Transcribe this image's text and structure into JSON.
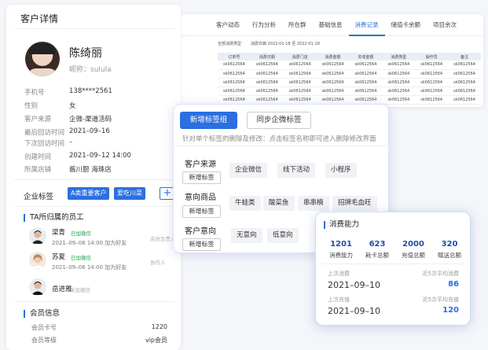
{
  "table_panel": {
    "tabs": [
      "客户动态",
      "行为分析",
      "所在群",
      "基础信息",
      "消费记录",
      "储值卡余额",
      "项目余次"
    ],
    "filter": [
      "全部消费类型",
      "消费日期 2022-01-18 至 2022-01-18"
    ],
    "headers": [
      "订单号",
      "消费日期",
      "消费门店",
      "消费金额",
      "实收金额",
      "消费类型",
      "操作员",
      "备注"
    ],
    "rows": [
      [
        "sk0612564",
        "sk0612564",
        "sk0612564",
        "sk0612564",
        "sk0612564",
        "sk0612564",
        "sk0612564",
        "sk0612564"
      ],
      [
        "sk0612564",
        "sk0612564",
        "sk0612564",
        "sk0612564",
        "sk0612564",
        "sk0612564",
        "sk0612564",
        "sk0612564"
      ],
      [
        "sk0612564",
        "sk0612564",
        "sk0612564",
        "sk0612564",
        "sk0612564",
        "sk0612564",
        "sk0612564",
        "sk0612564"
      ],
      [
        "sk0612564",
        "sk0612564",
        "sk0612564",
        "sk0612564",
        "sk0612564",
        "sk0612564",
        "sk0612564",
        "sk0612564"
      ],
      [
        "sk0612564",
        "sk0612564",
        "sk0612564",
        "sk0612564",
        "sk0612564",
        "sk0612564",
        "sk0612564",
        "sk0612564"
      ]
    ]
  },
  "customer": {
    "panel_title": "客户详情",
    "name": "陈绮丽",
    "nickname": "昵称：sulula",
    "fields": [
      {
        "label": "手机号",
        "value": "138****2561"
      },
      {
        "label": "性别",
        "value": "女"
      },
      {
        "label": "客户来源",
        "value": "企微-渠道活码"
      },
      {
        "label": "最后回访时间",
        "value": "2021–09–16"
      },
      {
        "label": "下次回访时间",
        "value": "–"
      },
      {
        "label": "创建时间",
        "value": "2021–09–12 14:00"
      },
      {
        "label": "所属店铺",
        "value": "酱川厨 海珠店"
      }
    ],
    "enterprise_tags_label": "企业标签",
    "enterprise_tags": [
      "A类重要客户",
      "爱吃川菜"
    ],
    "plus": "+",
    "employees_title": "TA所归属的员工",
    "employees": [
      {
        "name": "梁青",
        "badge": "已加微信",
        "sub": "2021–09–08 14:00 加为好友",
        "role": "店员负责人"
      },
      {
        "name": "苏夏",
        "badge": "已加微信",
        "sub": "2021–09–08 14:00 加为好友",
        "role": "协作人"
      },
      {
        "name": "岳进雅",
        "badge": "未加微信",
        "sub": "",
        "role": ""
      }
    ],
    "member_title": "会员信息",
    "member": [
      {
        "label": "会员卡号",
        "value": "1220"
      },
      {
        "label": "会员等级",
        "value": "vip会员"
      }
    ]
  },
  "tag_popup": {
    "btn_new_group": "新增标签组",
    "btn_sync": "同步企微标签",
    "hint": "针对单个标签的删除及修改：点击标签名称即可进入删除修改界面",
    "add_label": "新增标签",
    "groups": [
      {
        "label": "客户来源",
        "chips": [
          "企业微信",
          "线下活动",
          "小程序"
        ]
      },
      {
        "label": "意向商品",
        "chips": [
          "牛蛙类",
          "酸菜鱼",
          "串串楠",
          "招牌毛血旺"
        ]
      },
      {
        "label": "客户意向",
        "chips": [
          "无意向",
          "低意向"
        ]
      }
    ]
  },
  "consumption": {
    "title": "消费能力",
    "stats": [
      {
        "value": "1201",
        "label": "消费能力"
      },
      {
        "value": "623",
        "label": "耗卡总额"
      },
      {
        "value": "2000",
        "label": "充值总额"
      },
      {
        "value": "320",
        "label": "赠送总额"
      }
    ],
    "last_consume_label": "上次消费",
    "last_consume_date": "2021–09–10",
    "avg5_consume_label": "近5次平均消费",
    "avg5_consume_value": "86",
    "last_recharge_label": "上次充值",
    "last_recharge_date": "2021–09–10",
    "avg5_recharge_label": "近5次平均充值",
    "avg5_recharge_value": "120"
  }
}
